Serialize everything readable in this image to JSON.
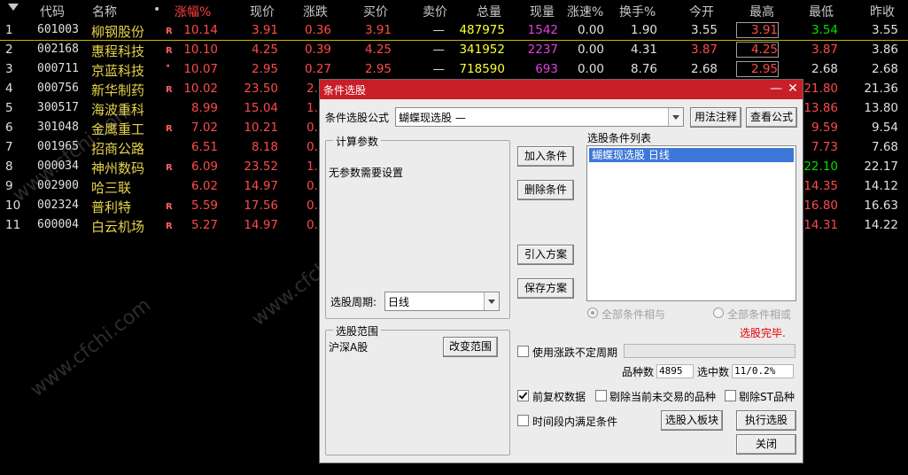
{
  "table": {
    "headers": {
      "code": "代码",
      "name": "名称",
      "dot": "•",
      "pct": "涨幅%",
      "price": "现价",
      "change": "涨跌",
      "bid": "买价",
      "ask": "卖价",
      "volume": "总量",
      "cur_vol": "现量",
      "speed": "涨速%",
      "turnover": "换手%",
      "open": "今开",
      "high": "最高",
      "low": "最低",
      "prev_close": "昨收"
    },
    "rows": [
      {
        "idx": "1",
        "code": "601003",
        "name": "柳钢股份",
        "flag": "R",
        "pct": "10.14",
        "price": "3.91",
        "change": "0.36",
        "bid": "3.91",
        "ask": "—",
        "volume": "487975",
        "cur_vol": "1542",
        "speed": "0.00",
        "turnover": "1.90",
        "open": "3.55",
        "high": "3.91",
        "low": "3.54",
        "prev_close": "3.55"
      },
      {
        "idx": "2",
        "code": "002168",
        "name": "惠程科技",
        "flag": "R",
        "pct": "10.10",
        "price": "4.25",
        "change": "0.39",
        "bid": "4.25",
        "ask": "—",
        "volume": "341952",
        "cur_vol": "2237",
        "speed": "0.00",
        "turnover": "4.31",
        "open": "3.87",
        "high": "4.25",
        "low": "3.87",
        "prev_close": "3.86"
      },
      {
        "idx": "3",
        "code": "000711",
        "name": "京蓝科技",
        "flag": "·",
        "pct": "10.07",
        "price": "2.95",
        "change": "0.27",
        "bid": "2.95",
        "ask": "—",
        "volume": "718590",
        "cur_vol": "693",
        "speed": "0.00",
        "turnover": "8.76",
        "open": "2.68",
        "high": "2.95",
        "low": "2.68",
        "prev_close": "2.68"
      },
      {
        "idx": "4",
        "code": "000756",
        "name": "新华制药",
        "flag": "R",
        "pct": "10.02",
        "price": "23.50",
        "change": "2.",
        "low": "21.80",
        "prev_close": "21.36"
      },
      {
        "idx": "5",
        "code": "300517",
        "name": "海波重科",
        "flag": "",
        "pct": "8.99",
        "price": "15.04",
        "change": "1.",
        "low": "13.86",
        "prev_close": "13.80"
      },
      {
        "idx": "6",
        "code": "301048",
        "name": "金鹰重工",
        "flag": "R",
        "pct": "7.02",
        "price": "10.21",
        "change": "0.",
        "low": "9.59",
        "prev_close": "9.54"
      },
      {
        "idx": "7",
        "code": "001965",
        "name": "招商公路",
        "flag": "",
        "pct": "6.51",
        "price": "8.18",
        "change": "0.",
        "low": "7.73",
        "prev_close": "7.68"
      },
      {
        "idx": "8",
        "code": "000034",
        "name": "神州数码",
        "flag": "R",
        "pct": "6.09",
        "price": "23.52",
        "change": "1.",
        "low": "22.10",
        "prev_close": "22.17"
      },
      {
        "idx": "9",
        "code": "002900",
        "name": "哈三联",
        "flag": "",
        "pct": "6.02",
        "price": "14.97",
        "change": "0.",
        "low": "14.35",
        "prev_close": "14.12"
      },
      {
        "idx": "10",
        "code": "002324",
        "name": "普利特",
        "flag": "R",
        "pct": "5.59",
        "price": "17.56",
        "change": "0.",
        "low": "16.80",
        "prev_close": "16.63"
      },
      {
        "idx": "11",
        "code": "600004",
        "name": "白云机场",
        "flag": "R",
        "pct": "5.27",
        "price": "14.97",
        "change": "0.",
        "low": "14.31",
        "prev_close": "14.22"
      }
    ]
  },
  "dialog": {
    "title": "条件选股",
    "minimize": "—",
    "close": "✕",
    "formula_label": "条件选股公式",
    "formula_value": "蝴蝶现选股    —",
    "usage_btn": "用法注释",
    "view_formula_btn": "查看公式",
    "params_group": "计算参数",
    "no_params": "无参数需要设置",
    "period_label": "选股周期:",
    "period_value": "日线",
    "range_group": "选股范围",
    "range_value": "沪深A股",
    "change_range_btn": "改变范围",
    "add_cond_btn": "加入条件",
    "del_cond_btn": "删除条件",
    "import_plan_btn": "引入方案",
    "save_plan_btn": "保存方案",
    "cond_list_label": "选股条件列表",
    "cond_items": [
      "蝴蝶现选股  日线"
    ],
    "radio_and": "全部条件相与",
    "radio_or": "全部条件相或",
    "status": "选股完毕.",
    "use_irregular": "使用涨跌不定周期",
    "count_label": "品种数",
    "count_value": "4895",
    "selected_label": "选中数",
    "selected_value": "11/0.2%",
    "pre_adjust": "前复权数据",
    "exclude_untraded": "剔除当前未交易的品种",
    "exclude_st": "剔除ST品种",
    "time_range": "时间段内满足条件",
    "to_board_btn": "选股入板块",
    "run_btn": "执行选股",
    "close_btn": "关闭"
  },
  "watermark": "www.cfchi.com",
  "colors": {
    "up": "#ff4a4a",
    "down": "#00e000",
    "name": "#e6d34a",
    "volume": "#ffff30",
    "cur_vol": "#e040e0",
    "title_bar": "#c81e28"
  }
}
